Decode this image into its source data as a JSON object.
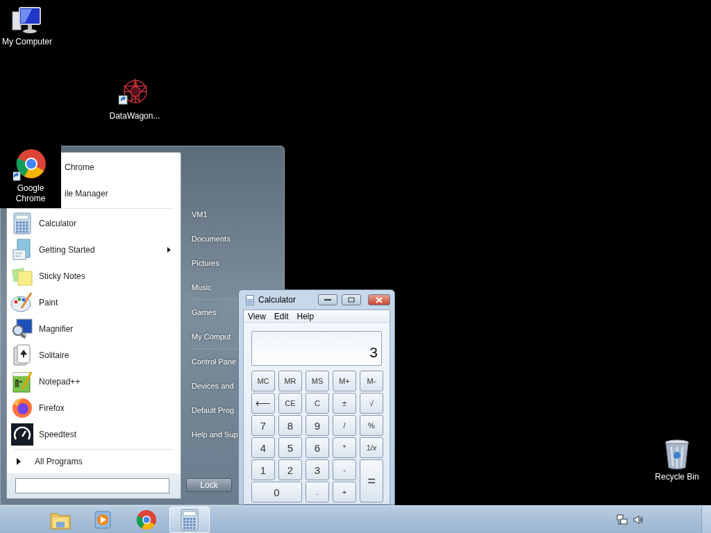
{
  "desktop_icons": [
    {
      "label": "My Computer",
      "kind": "computer"
    },
    {
      "label": "DataWagon...",
      "kind": "datawagon"
    },
    {
      "label": "Recycle Bin",
      "kind": "recycle"
    },
    {
      "label": "Google Chrome",
      "kind": "chrome"
    }
  ],
  "start_menu": {
    "pinned": [
      {
        "label": "Chrome"
      },
      {
        "label": "ile Manager"
      }
    ],
    "programs": [
      {
        "label": "Calculator",
        "kind": "calculator",
        "has_submenu": false
      },
      {
        "label": "Getting Started",
        "kind": "getting-started",
        "has_submenu": true
      },
      {
        "label": "Sticky Notes",
        "kind": "sticky-notes",
        "has_submenu": false
      },
      {
        "label": "Paint",
        "kind": "paint",
        "has_submenu": false
      },
      {
        "label": "Magnifier",
        "kind": "magnifier",
        "has_submenu": false
      },
      {
        "label": "Solitaire",
        "kind": "solitaire",
        "has_submenu": false
      },
      {
        "label": "Notepad++",
        "kind": "notepad",
        "has_submenu": false
      },
      {
        "label": "Firefox",
        "kind": "firefox",
        "has_submenu": false
      },
      {
        "label": "Speedtest",
        "kind": "speedtest",
        "has_submenu": false
      }
    ],
    "all_programs": "All Programs",
    "places": [
      {
        "label": "VM1",
        "separator_after": false
      },
      {
        "label": "Documents",
        "separator_after": false
      },
      {
        "label": "Pictures",
        "separator_after": false
      },
      {
        "label": "Music",
        "separator_after": true
      },
      {
        "label": "Games",
        "separator_after": false
      },
      {
        "label": "My Comput",
        "separator_after": true
      },
      {
        "label": "Control Pane",
        "separator_after": false
      },
      {
        "label": "Devices and",
        "separator_after": false
      },
      {
        "label": "Default Prog",
        "separator_after": false
      },
      {
        "label": "Help and Sup",
        "separator_after": false
      }
    ],
    "lock_button": "Lock"
  },
  "calculator": {
    "title": "Calculator",
    "menu": [
      "View",
      "Edit",
      "Help"
    ],
    "display": "3",
    "keys": [
      {
        "label": "MC",
        "kind": "small"
      },
      {
        "label": "MR",
        "kind": "small"
      },
      {
        "label": "MS",
        "kind": "small"
      },
      {
        "label": "M+",
        "kind": "small"
      },
      {
        "label": "M-",
        "kind": "small"
      },
      {
        "label": "⟵",
        "kind": "normal"
      },
      {
        "label": "CE",
        "kind": "small"
      },
      {
        "label": "C",
        "kind": "small"
      },
      {
        "label": "±",
        "kind": "small"
      },
      {
        "label": "√",
        "kind": "small"
      },
      {
        "label": "7",
        "kind": "normal"
      },
      {
        "label": "8",
        "kind": "normal"
      },
      {
        "label": "9",
        "kind": "normal"
      },
      {
        "label": "/",
        "kind": "small"
      },
      {
        "label": "%",
        "kind": "small"
      },
      {
        "label": "4",
        "kind": "normal"
      },
      {
        "label": "5",
        "kind": "normal"
      },
      {
        "label": "6",
        "kind": "normal"
      },
      {
        "label": "*",
        "kind": "small"
      },
      {
        "label": "1/*x*",
        "kind": "small"
      },
      {
        "label": "1",
        "kind": "normal"
      },
      {
        "label": "2",
        "kind": "normal"
      },
      {
        "label": "3",
        "kind": "normal"
      },
      {
        "label": "-",
        "kind": "small"
      },
      {
        "label": "=",
        "kind": "tall"
      },
      {
        "label": "0",
        "kind": "wide"
      },
      {
        "label": ".",
        "kind": "small"
      },
      {
        "label": "+",
        "kind": "small"
      }
    ]
  },
  "taskbar": {
    "items": [
      {
        "kind": "folder",
        "selected": false
      },
      {
        "kind": "media",
        "selected": false
      },
      {
        "kind": "chrome",
        "selected": false
      },
      {
        "kind": "calculator",
        "selected": true
      }
    ]
  }
}
